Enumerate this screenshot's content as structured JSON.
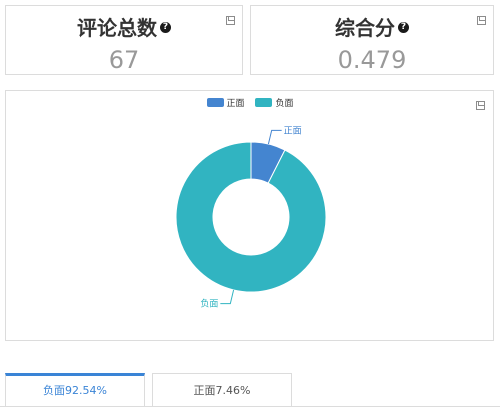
{
  "cards": [
    {
      "title": "评论总数",
      "value": "67"
    },
    {
      "title": "综合分",
      "value": "0.479"
    }
  ],
  "chart": {
    "legend": [
      "正面",
      "负面"
    ],
    "labels": {
      "positive": "正面",
      "negative": "负面"
    }
  },
  "chart_data": {
    "type": "pie",
    "donut": true,
    "categories": [
      "正面",
      "负面"
    ],
    "values": [
      7.46,
      92.54
    ],
    "colors": [
      "#4485d0",
      "#31b4c1"
    ],
    "legend_placement": "top-center"
  },
  "tabs": [
    {
      "label": "负面92.54%",
      "active": true
    },
    {
      "label": "正面7.46%",
      "active": false
    }
  ],
  "colors": {
    "accent": "#3a84d6",
    "positive": "#4485d0",
    "negative": "#31b4c1",
    "value_text": "#999999"
  },
  "icons": {
    "help": "?",
    "save": "save-icon"
  }
}
